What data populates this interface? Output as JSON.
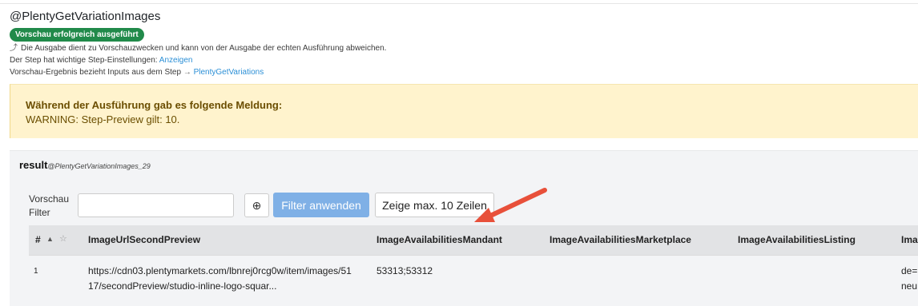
{
  "header": {
    "title": "@PlentyGetVariationImages",
    "badge": "Vorschau erfolgreich ausgeführt",
    "note_icon": "return-arrow-icon",
    "note": "Die Ausgabe dient zu Vorschauzwecken und kann von der Ausgabe der echten Ausführung abweichen.",
    "settings_text": "Der Step hat wichtige Step-Einstellungen:",
    "settings_link": "Anzeigen",
    "inputs_text": "Vorschau-Ergebnis bezieht Inputs aus dem Step",
    "inputs_link": "PlentyGetVariations"
  },
  "alert": {
    "title": "Während der Ausführung gab es folgende Meldung:",
    "message": "WARNING: Step-Preview gilt: 10."
  },
  "result": {
    "title": "result",
    "subtitle": "@PlentyGetVariationImages_29",
    "filter_label": "Vorschau Filter",
    "filter_value": "",
    "apply_label": "Filter anwenden",
    "rows_label": "Zeige max. 10 Zeilen"
  },
  "table": {
    "columns": [
      "#",
      "ImageUrlSecondPreview",
      "ImageAvailabilitiesMandant",
      "ImageAvailabilitiesMarketplace",
      "ImageAvailabilitiesListing",
      "Ima"
    ],
    "rows": [
      {
        "index": "1",
        "ImageUrlSecondPreview_line1": "https://cdn03.plentymarkets.com/lbnrej0rcg0w/item/images/51",
        "ImageUrlSecondPreview_line2": "17/secondPreview/studio-inline-logo-squar...",
        "ImageAvailabilitiesMandant": "53313;53312",
        "ImageAvailabilitiesMarketplace": "",
        "ImageAvailabilitiesListing": "",
        "last_line1": "de=",
        "last_line2": "neu"
      }
    ]
  },
  "colors": {
    "badge": "#218a4a",
    "link": "#2b8fd6",
    "alert_bg": "#fff3cd",
    "apply_button": "#7fb0e6",
    "annotation_arrow": "#e8503a"
  }
}
